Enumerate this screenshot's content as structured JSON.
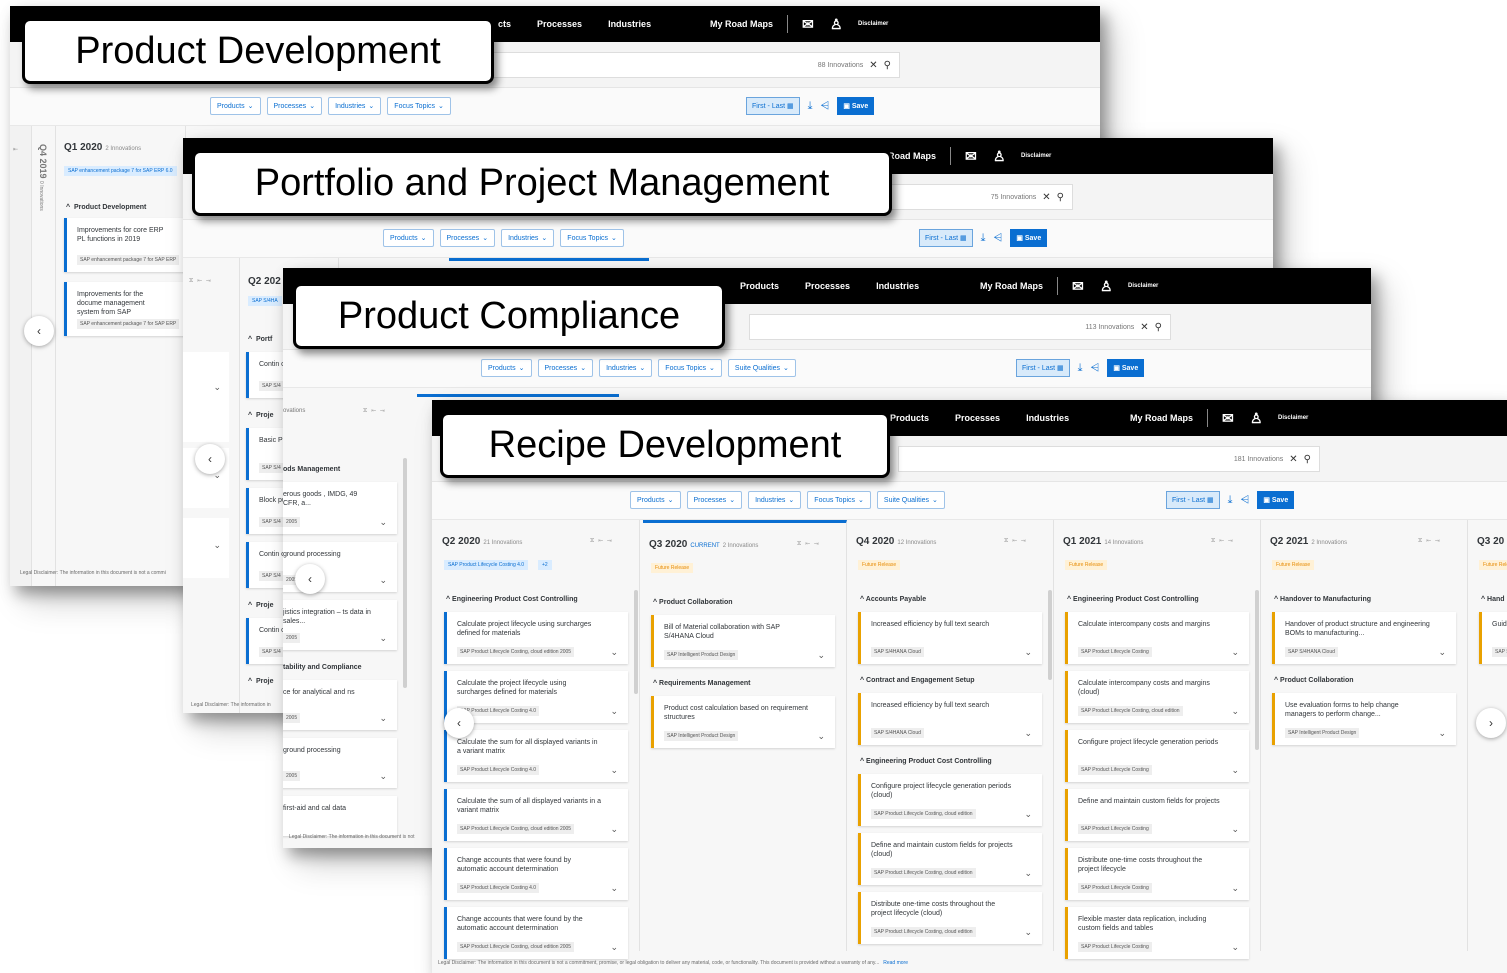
{
  "callouts": [
    "Product Development",
    "Portfolio and Project Management",
    "Product Compliance",
    "Recipe Development"
  ],
  "nav": {
    "partial_products": "cts",
    "products": "Products",
    "processes": "Processes",
    "industries": "Industries",
    "my_road_maps": "My Road Maps",
    "partial_road_maps": "/ Road Maps",
    "disclaimer": "Disclaimer"
  },
  "search_counts": {
    "w1": "88 Innovations",
    "w2": "75 Innovations",
    "w3": "113 Innovations",
    "w4": "181 Innovations"
  },
  "filters": {
    "products": "Products",
    "processes": "Processes",
    "industries": "Industries",
    "focus_topics": "Focus Topics",
    "suite_qualities": "Suite Qualities"
  },
  "toolbar": {
    "range": "First - Last",
    "save": "Save"
  },
  "legal": {
    "short": "Legal Disclaimer: The information in this document is not a commi",
    "short2": "Legal Disclaimer: The information in",
    "short3": "Legal Disclaimer: The information in this document is not",
    "full": "Legal Disclaimer: The information in this document is not a commitment, promise, or legal obligation to deliver any material, code, or functionality. This document is provided without a warranty of any...",
    "read_more": "Read more"
  },
  "w1": {
    "q4_2019": "Q4 2019",
    "q4_2019_sub": "0 Innovations",
    "q1_2020": "Q1 2020",
    "q1_2020_sub": "2 Innovations",
    "tag": "SAP enhancement package 7 for SAP ERP 6.0",
    "section": "Product Development",
    "cards": [
      {
        "title": "Improvements for core ERP PL functions in 2019",
        "sub": "SAP enhancement package 7 for SAP ERP"
      },
      {
        "title": "Improvements for the docume management system from SAP",
        "sub": "SAP enhancement package 7 for SAP ERP"
      }
    ]
  },
  "w2": {
    "q2": "Q2 202",
    "tag": "SAP S/4HA",
    "sect1": "Portf",
    "sect2": "Proje",
    "sect3": "Proje",
    "sect4": "Proje",
    "cards": [
      "Contin custom",
      "Basic Project",
      "Block purcha",
      "Contin custom",
      "Contin custom"
    ],
    "subs": [
      "SAP S/4",
      "SAP S/4",
      "SAP S/4",
      "SAP S/4",
      "SAP S/4"
    ]
  },
  "w3": {
    "innovations": "ovations",
    "sect1": "ods Management",
    "sect2": "tability and Compliance",
    "cards": [
      "erous goods , IMDG, 49 CFR, a...",
      "ground processing",
      "jistics integration – ts data in sales...",
      "ce for analytical and ns",
      "ground processing",
      "first-aid and cal data"
    ],
    "subs": [
      "2005",
      "2005",
      "2005",
      "2005",
      "2005"
    ]
  },
  "w4": {
    "columns": [
      {
        "quarter": "Q2 2020",
        "count": "21 Innovations",
        "current": "",
        "tags": [
          "SAP Product Lifecycle Costing 4.0",
          "+2"
        ],
        "tag_style": "blue",
        "sections": [
          {
            "title": "Engineering Product Cost Controlling",
            "cards": [
              {
                "title": "Calculate project lifecycle using surcharges defined for materials",
                "sub": "SAP Product Lifecycle Costing, cloud edition 2005"
              },
              {
                "title": "Calculate the project lifecycle using surcharges defined for materials",
                "sub": "SAP Product Lifecycle Costing 4.0"
              },
              {
                "title": "Calculate the sum for all displayed variants in a variant matrix",
                "sub": "SAP Product Lifecycle Costing 4.0"
              },
              {
                "title": "Calculate the sum of all displayed variants in a variant matrix",
                "sub": "SAP Product Lifecycle Costing, cloud edition 2005"
              },
              {
                "title": "Change accounts that were found by automatic account determination",
                "sub": "SAP Product Lifecycle Costing 4.0"
              },
              {
                "title": "Change accounts that were found by the automatic account determination",
                "sub": "SAP Product Lifecycle Costing, cloud edition 2005"
              }
            ]
          }
        ]
      },
      {
        "quarter": "Q3 2020",
        "count": "2 Innovations",
        "current": "CURRENT",
        "tags": [
          "Future Release"
        ],
        "tag_style": "orange",
        "sections": [
          {
            "title": "Product Collaboration",
            "cards": [
              {
                "title": "Bill of Material collaboration with SAP S/4HANA Cloud",
                "sub": "SAP Intelligent Product Design"
              }
            ]
          },
          {
            "title": "Requirements Management",
            "cards": [
              {
                "title": "Product cost calculation based on requirement structures",
                "sub": "SAP Intelligent Product Design"
              }
            ]
          }
        ]
      },
      {
        "quarter": "Q4 2020",
        "count": "12 Innovations",
        "current": "",
        "tags": [
          "Future Release"
        ],
        "tag_style": "orange",
        "sections": [
          {
            "title": "Accounts Payable",
            "cards": [
              {
                "title": "Increased efficiency by full text search",
                "sub": "SAP S/4HANA Cloud"
              }
            ]
          },
          {
            "title": "Contract and Engagement Setup",
            "cards": [
              {
                "title": "Increased efficiency by full text search",
                "sub": "SAP S/4HANA Cloud"
              }
            ]
          },
          {
            "title": "Engineering Product Cost Controlling",
            "cards": [
              {
                "title": "Configure project lifecycle generation periods (cloud)",
                "sub": "SAP Product Lifecycle Costing, cloud edition"
              },
              {
                "title": "Define and maintain custom fields for projects (cloud)",
                "sub": "SAP Product Lifecycle Costing, cloud edition"
              },
              {
                "title": "Distribute one-time costs throughout the project lifecycle (cloud)",
                "sub": "SAP Product Lifecycle Costing, cloud edition"
              }
            ]
          }
        ]
      },
      {
        "quarter": "Q1 2021",
        "count": "14 Innovations",
        "current": "",
        "tags": [
          "Future Release"
        ],
        "tag_style": "orange",
        "sections": [
          {
            "title": "Engineering Product Cost Controlling",
            "cards": [
              {
                "title": "Calculate intercompany costs and margins",
                "sub": "SAP Product Lifecycle Costing"
              },
              {
                "title": "Calculate intercompany costs and margins (cloud)",
                "sub": "SAP Product Lifecycle Costing, cloud edition"
              },
              {
                "title": "Configure project lifecycle generation periods",
                "sub": "SAP Product Lifecycle Costing"
              },
              {
                "title": "Define and maintain custom fields for projects",
                "sub": "SAP Product Lifecycle Costing"
              },
              {
                "title": "Distribute one-time costs throughout the project lifecycle",
                "sub": "SAP Product Lifecycle Costing"
              },
              {
                "title": "Flexible master data replication, including custom fields and tables",
                "sub": "SAP Product Lifecycle Costing"
              }
            ]
          }
        ]
      },
      {
        "quarter": "Q2 2021",
        "count": "2 Innovations",
        "current": "",
        "tags": [
          "Future Release"
        ],
        "tag_style": "orange",
        "sections": [
          {
            "title": "Handover to Manufacturing",
            "cards": [
              {
                "title": "Handover of product structure and engineering BOMs to manufacturing...",
                "sub": "SAP S/4HANA Cloud"
              }
            ]
          },
          {
            "title": "Product Collaboration",
            "cards": [
              {
                "title": "Use evaluation forms to help change managers to perform change...",
                "sub": "SAP Intelligent Product Design"
              }
            ]
          }
        ]
      },
      {
        "quarter": "Q3 20",
        "count": "",
        "current": "",
        "tags": [
          "Future Rele"
        ],
        "tag_style": "orange",
        "sections": [
          {
            "title": "Hand",
            "cards": [
              {
                "title": "Guide MBO",
                "sub": "SAP S"
              }
            ]
          }
        ]
      }
    ]
  }
}
